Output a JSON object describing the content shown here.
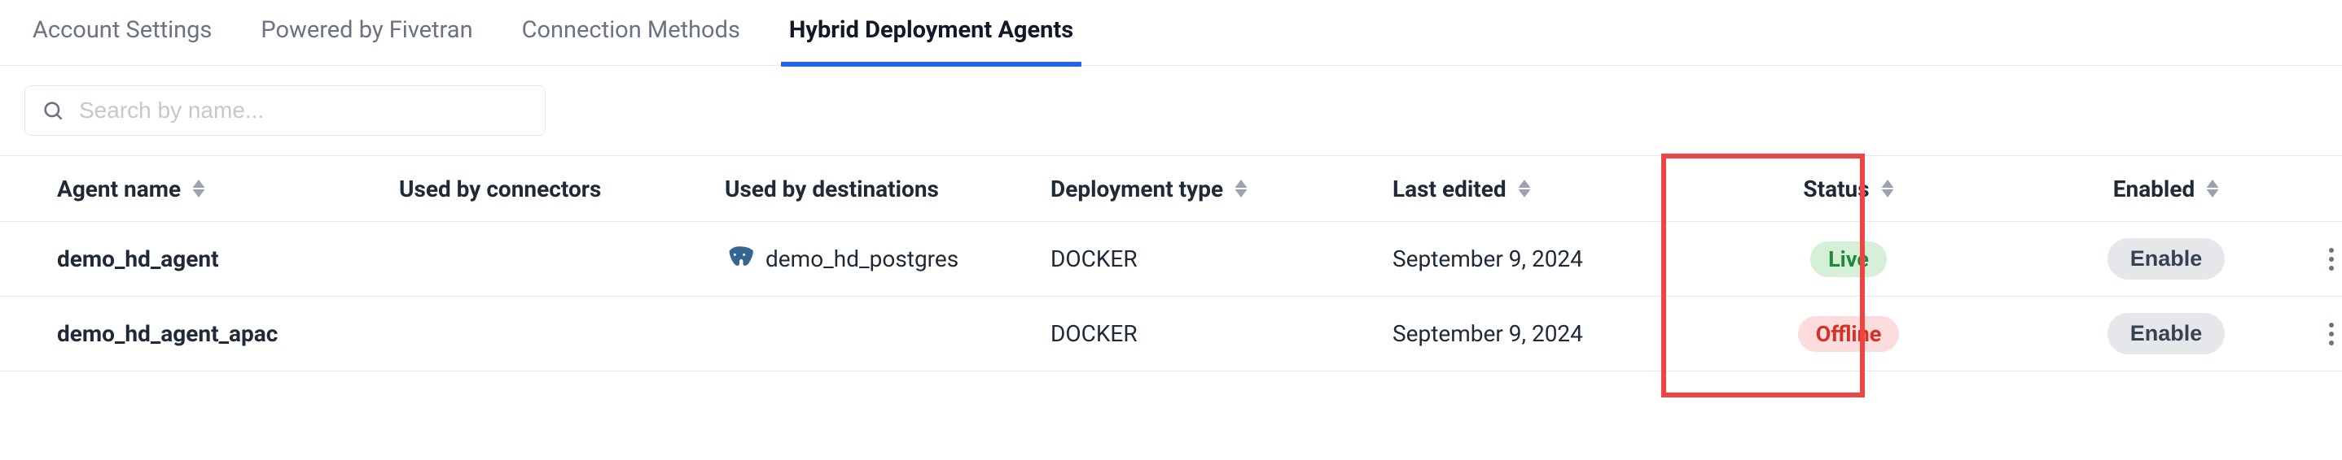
{
  "tabs": {
    "items": [
      {
        "label": "Account Settings",
        "active": false
      },
      {
        "label": "Powered by Fivetran",
        "active": false
      },
      {
        "label": "Connection Methods",
        "active": false
      },
      {
        "label": "Hybrid Deployment Agents",
        "active": true
      }
    ]
  },
  "search": {
    "placeholder": "Search by name..."
  },
  "table": {
    "columns": {
      "agent_name": "Agent name",
      "used_by_connectors": "Used by connectors",
      "used_by_destinations": "Used by destinations",
      "deployment_type": "Deployment type",
      "last_edited": "Last edited",
      "status": "Status",
      "enabled": "Enabled"
    },
    "rows": [
      {
        "agent_name": "demo_hd_agent",
        "used_by_connectors": "",
        "used_by_destinations": "demo_hd_postgres",
        "deployment_type": "DOCKER",
        "last_edited": "September 9, 2024",
        "status": "Live",
        "status_class": "status-live",
        "enabled_label": "Enable"
      },
      {
        "agent_name": "demo_hd_agent_apac",
        "used_by_connectors": "",
        "used_by_destinations": "",
        "deployment_type": "DOCKER",
        "last_edited": "September 9, 2024",
        "status": "Offline",
        "status_class": "status-offline",
        "enabled_label": "Enable"
      }
    ]
  }
}
